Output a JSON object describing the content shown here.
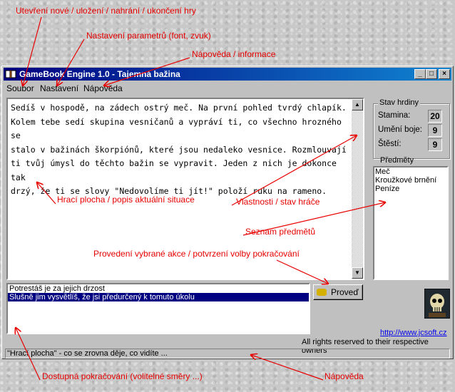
{
  "annotations": {
    "open_save": "Utevření nové / uložení / nahrání / ukončení hry",
    "settings": "Nastavení parametrů (font, zvuk)",
    "help_info": "Nápověda / informace",
    "game_area": "Hrací plocha / popis aktuální situace",
    "player_stats": "Vlastnosti / stav hráče",
    "item_list": "Seznam předmětů",
    "execute_action": "Provedení vybrané akce  / potvrzení volby pokračování",
    "available_choices": "Dostupná pokračování (volitelné směry ...)",
    "help": "Nápověda"
  },
  "window": {
    "title": "GameBook Engine 1.0 - Tajemná bažina",
    "controls": {
      "minimize": "_",
      "maximize": "□",
      "close": "×"
    }
  },
  "menu": {
    "file": "Soubor",
    "settings": "Nastavení",
    "help": "Nápověda"
  },
  "story": {
    "text": "Sedíš v hospodě, na zádech ostrý meč. Na první pohled tvrdý chlapík.\nKolem tebe sedí skupina vesničanů a vypráví ti, co všechno hrozného se\nstalo v bažinách škorpiónů, které jsou nedaleko vesnice. Rozmlouvají\nti tvůj úmysl do těchto bažin se vypravit. Jeden z nich je dokonce tak\ndrzý, že ti se slovy \"Nedovolíme ti jít!\" položí ruku na rameno."
  },
  "stats": {
    "title": "Stav hrdiny",
    "stamina_label": "Stamina:",
    "stamina_value": "20",
    "skill_label": "Umění boje:",
    "skill_value": "9",
    "luck_label": "Štěstí:",
    "luck_value": "9"
  },
  "items": {
    "title": "Předměty",
    "list": [
      "Meč",
      "Kroužkové brnění",
      "Peníze"
    ]
  },
  "choices": {
    "list": [
      "Potrestáš je za jejich drzost",
      "Slušně jim vysvětlíš, že jsi předurčený k tomuto úkolu"
    ],
    "selected_index": 1
  },
  "action_button": {
    "label": "Proveď"
  },
  "footer": {
    "link": "http://www.jcsoft.cz",
    "rights": "All rights reserved to their respective owners"
  },
  "status_bar": {
    "text": "\"Hrací plocha\" - co se zrovna děje, co vidíte ..."
  },
  "colors": {
    "annotation": "#e80000",
    "titlebar": "#000080",
    "selection": "#000080",
    "link": "#0000ee"
  }
}
